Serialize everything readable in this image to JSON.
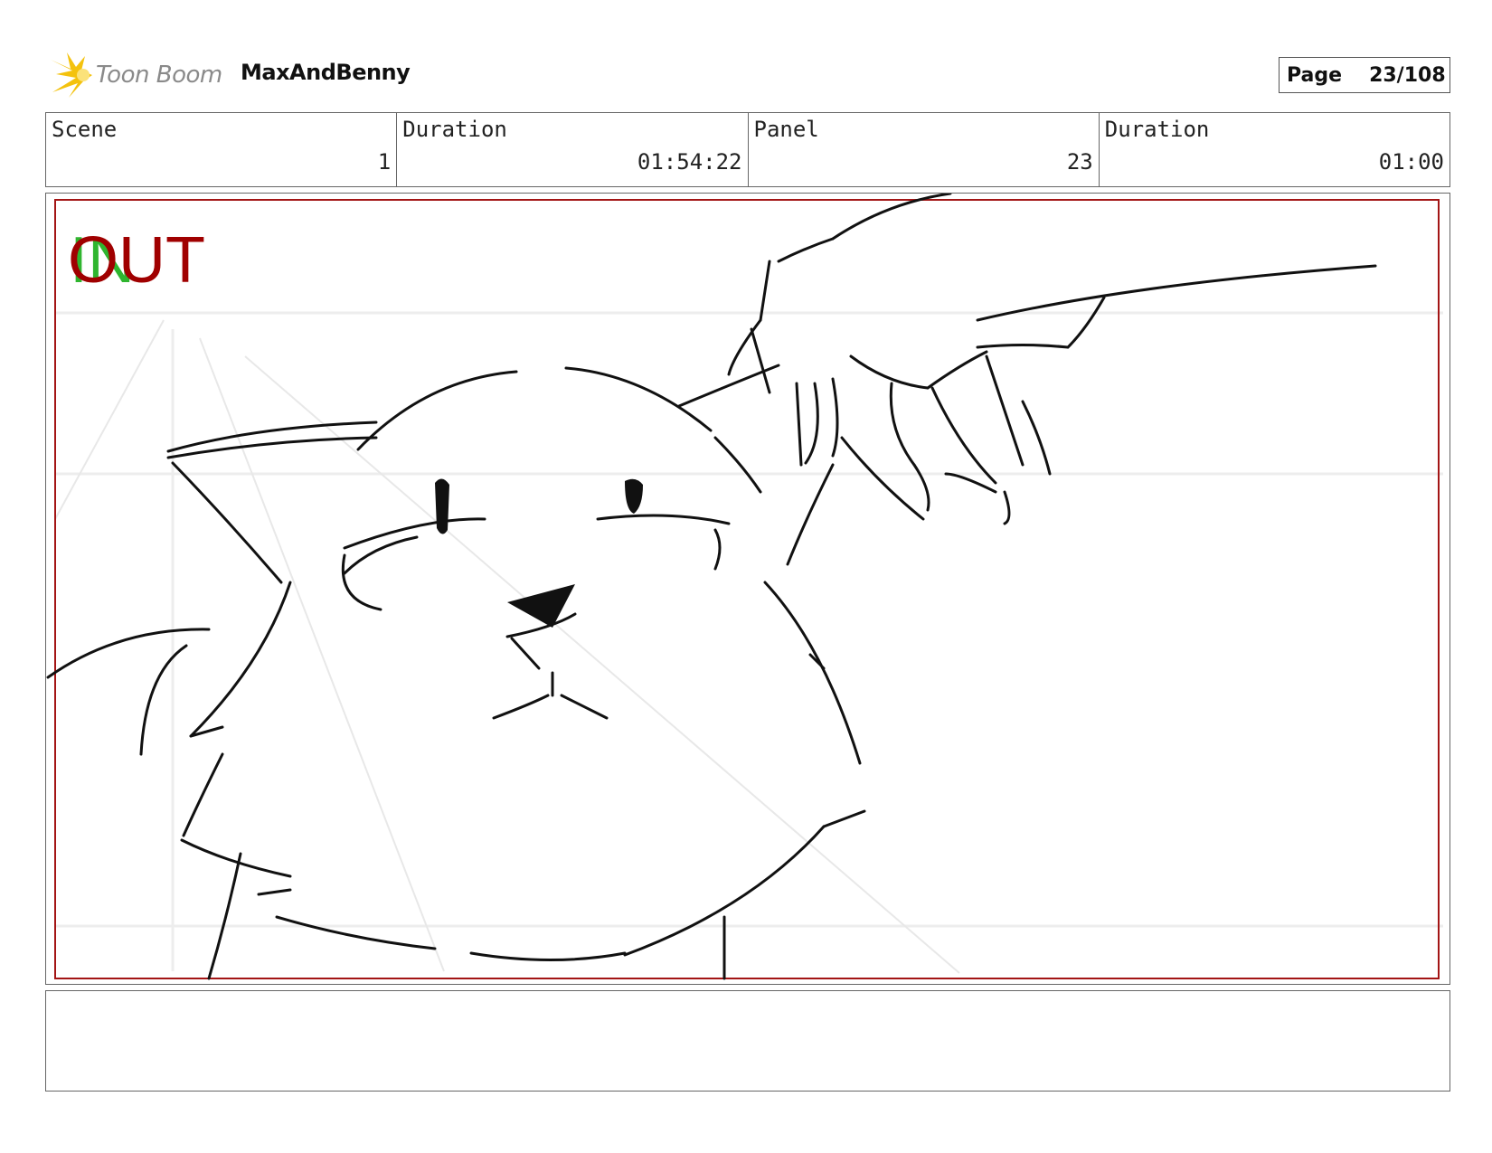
{
  "header": {
    "logo_text": "Toon Boom",
    "project_title": "MaxAndBenny",
    "page_label": "Page",
    "page_number": "23/108"
  },
  "info": {
    "scene_label": "Scene",
    "scene_value": "1",
    "scene_duration_label": "Duration",
    "scene_duration_value": "01:54:22",
    "panel_label": "Panel",
    "panel_value": "23",
    "panel_duration_label": "Duration",
    "panel_duration_value": "01:00"
  },
  "panel": {
    "in_marker": "IN",
    "out_marker": "OUT"
  },
  "colors": {
    "frame_red": "#a31515",
    "in_green": "#2fb52f",
    "out_red": "#a00000",
    "logo_yellow": "#f4c20d"
  },
  "notes": {
    "text": ""
  }
}
